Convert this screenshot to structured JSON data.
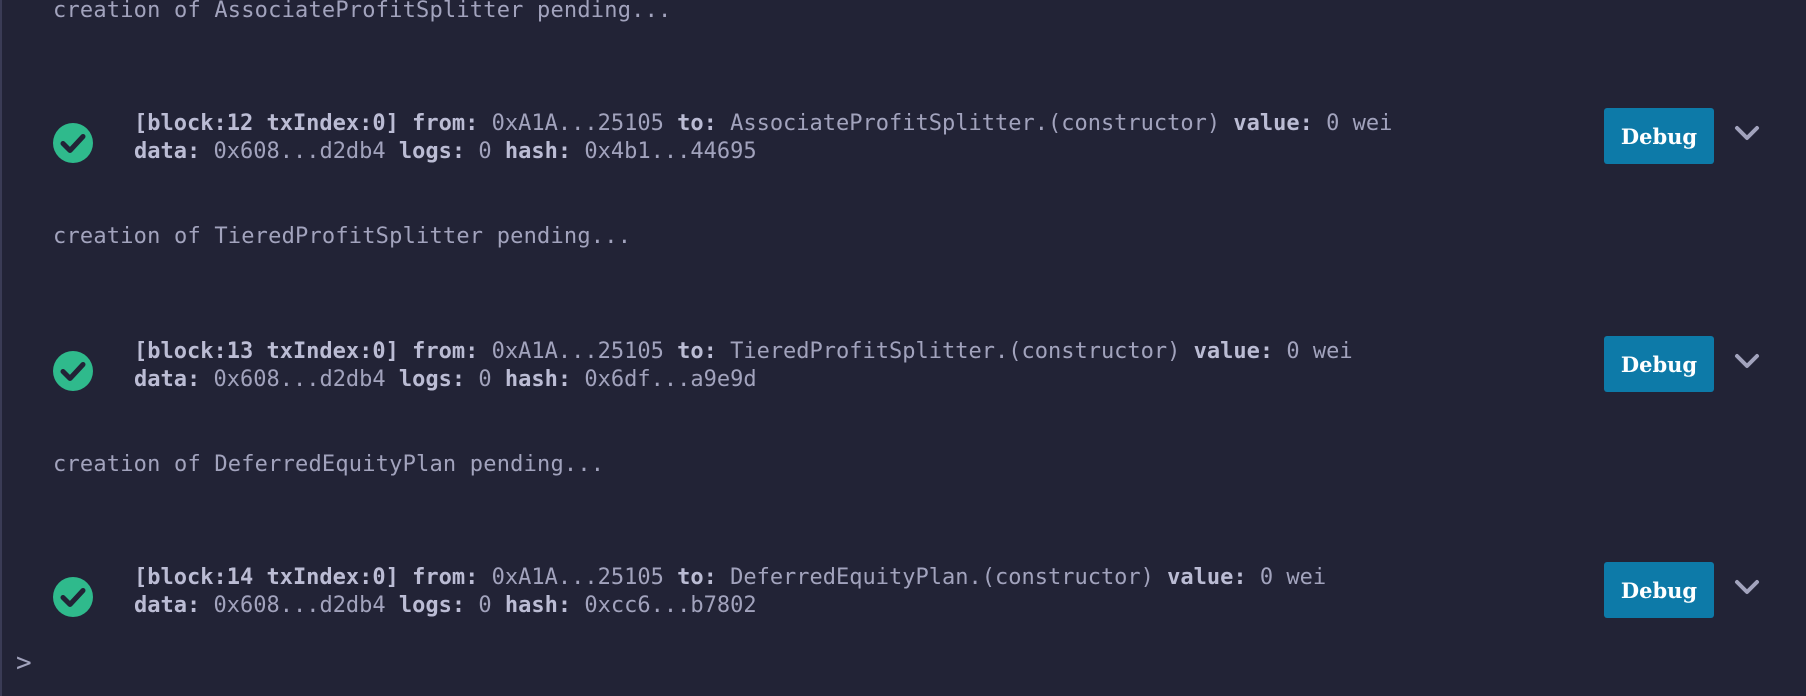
{
  "terminal": {
    "prompt": ">",
    "pending_messages": [
      "creation of AssociateProfitSplitter pending...",
      "creation of TieredProfitSplitter pending...",
      "creation of DeferredEquityPlan pending..."
    ],
    "transactions": [
      {
        "block_label": "[block:12 txIndex:0]",
        "from_label": "from:",
        "from": "0xA1A...25105",
        "to_label": "to:",
        "to": "AssociateProfitSplitter.(constructor)",
        "value_label": "value:",
        "value": "0 wei",
        "data_label": "data:",
        "data": "0x608...d2db4",
        "logs_label": "logs:",
        "logs": "0",
        "hash_label": "hash:",
        "hash": "0x4b1...44695",
        "debug_label": "Debug",
        "status_icon": "check-circle-icon"
      },
      {
        "block_label": "[block:13 txIndex:0]",
        "from_label": "from:",
        "from": "0xA1A...25105",
        "to_label": "to:",
        "to": "TieredProfitSplitter.(constructor)",
        "value_label": "value:",
        "value": "0 wei",
        "data_label": "data:",
        "data": "0x608...d2db4",
        "logs_label": "logs:",
        "logs": "0",
        "hash_label": "hash:",
        "hash": "0x6df...a9e9d",
        "debug_label": "Debug",
        "status_icon": "check-circle-icon"
      },
      {
        "block_label": "[block:14 txIndex:0]",
        "from_label": "from:",
        "from": "0xA1A...25105",
        "to_label": "to:",
        "to": "DeferredEquityPlan.(constructor)",
        "value_label": "value:",
        "value": "0 wei",
        "data_label": "data:",
        "data": "0x608...d2db4",
        "logs_label": "logs:",
        "logs": "0",
        "hash_label": "hash:",
        "hash": "0xcc6...b7802",
        "debug_label": "Debug",
        "status_icon": "check-circle-icon"
      }
    ]
  },
  "colors": {
    "background": "#222336",
    "text": "#a2a3bd",
    "success": "#2fba8c",
    "debug_button": "#0d7aa8"
  }
}
